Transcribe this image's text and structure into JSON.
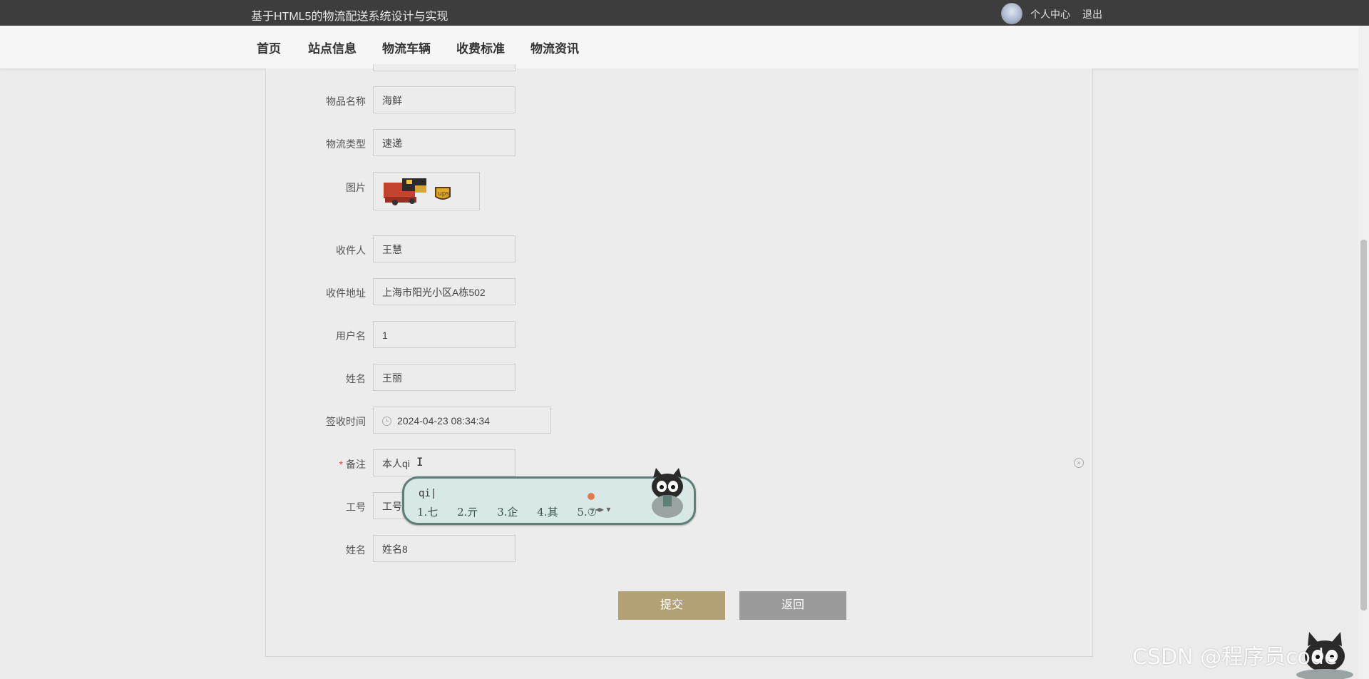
{
  "header": {
    "site_title": "基于HTML5的物流配送系统设计与实现",
    "personal_center": "个人中心",
    "logout": "退出"
  },
  "nav": {
    "items": [
      {
        "label": "首页"
      },
      {
        "label": "站点信息"
      },
      {
        "label": "物流车辆"
      },
      {
        "label": "收费标准"
      },
      {
        "label": "物流资讯"
      }
    ]
  },
  "form": {
    "item_name": {
      "label": "物品名称",
      "value": "海鲜"
    },
    "logistics_type": {
      "label": "物流类型",
      "value": "速递"
    },
    "image": {
      "label": "图片"
    },
    "recipient": {
      "label": "收件人",
      "value": "王慧"
    },
    "address": {
      "label": "收件地址",
      "value": "上海市阳光小区A栋502"
    },
    "username": {
      "label": "用户名",
      "value": "1"
    },
    "name": {
      "label": "姓名",
      "value": "王丽"
    },
    "sign_time": {
      "label": "签收时间",
      "value": "2024-04-23 08:34:34"
    },
    "remark": {
      "label": "备注",
      "required_mark": "*",
      "value": "本人qi"
    },
    "staff_no": {
      "label": "工号",
      "value": "工号"
    },
    "staff_name": {
      "label": "姓名",
      "value": "姓名8"
    },
    "submit_label": "提交",
    "back_label": "返回"
  },
  "ime": {
    "composition": "qi|",
    "candidates": [
      "1.七",
      "2.亓",
      "3.企",
      "4.其",
      "5.⑦"
    ]
  },
  "watermark": "CSDN @程序员code",
  "colors": {
    "submit": "#b3a176",
    "back": "#9a9a9a",
    "topbar": "#3d3d3d",
    "ime_bg": "#d7e8e6"
  }
}
